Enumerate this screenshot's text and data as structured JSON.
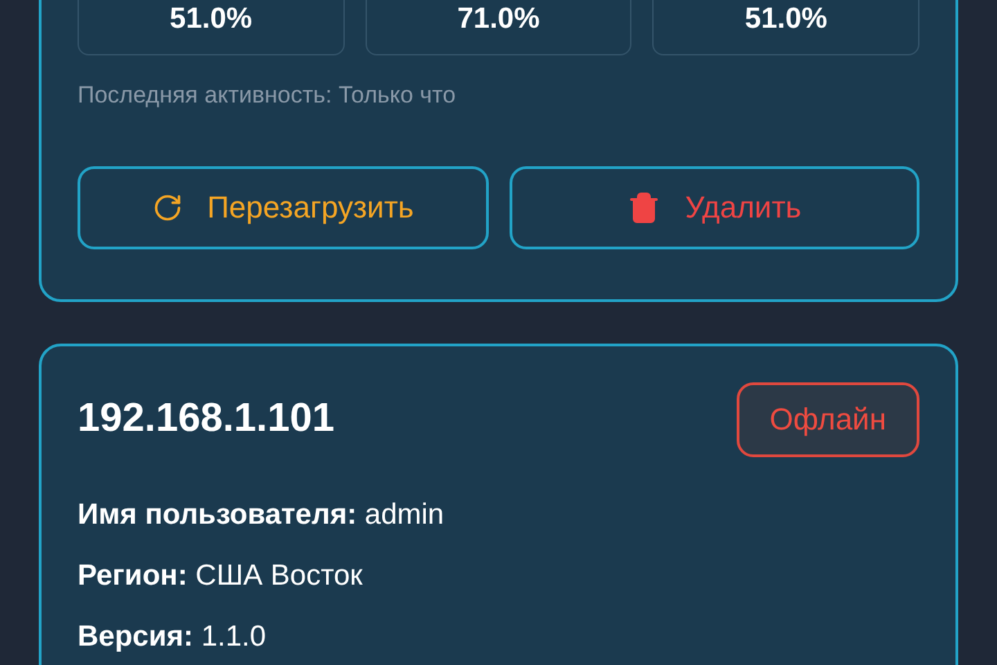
{
  "servers": [
    {
      "metrics": [
        "51.0%",
        "71.0%",
        "51.0%"
      ],
      "last_activity": "Последняя активность: Только что",
      "buttons": [
        {
          "kind": "restart",
          "label": "Перезагрузить"
        },
        {
          "kind": "delete",
          "label": "Удалить"
        }
      ]
    },
    {
      "title": "192.168.1.101",
      "status": {
        "kind": "offline",
        "label": "Офлайн"
      },
      "details": [
        "**Имя пользователя:** admin",
        "**Регион:** США Восток",
        "**Версия:** 1.1.0"
      ]
    }
  ]
}
